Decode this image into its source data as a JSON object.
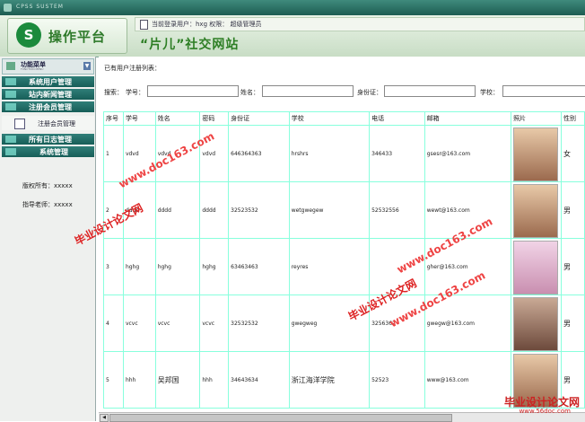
{
  "titlebar": {
    "text": "CPSS SUSTEM"
  },
  "header": {
    "logo_text": "操作平台",
    "user_info": "当前登录用户：hxg  权限：  超级管理员",
    "site_title": "“片儿”社交网站"
  },
  "sidebar": {
    "menu_title": "功能菜单",
    "menu_subtitle": "FUNCTION MENU",
    "items": [
      {
        "label": "系统用户管理"
      },
      {
        "label": "站内新闻管理"
      },
      {
        "label": "注册会员管理"
      }
    ],
    "active_subitem": "注册会员管理",
    "items2": [
      {
        "label": "所有日志管理"
      },
      {
        "label": "系统管理"
      }
    ],
    "copyright": "版权所有：xxxxx",
    "advisor": "指导老师：xxxxx"
  },
  "main": {
    "title": "已有用户注册列表：",
    "search": {
      "label": "搜索：",
      "fields": [
        {
          "label": "学号："
        },
        {
          "label": "姓名："
        },
        {
          "label": "身份证："
        },
        {
          "label": "学校："
        }
      ]
    },
    "columns": [
      "序号",
      "学号",
      "姓名",
      "密码",
      "身份证",
      "学校",
      "电话",
      "邮箱",
      "照片",
      "性别"
    ],
    "rows": [
      {
        "no": "1",
        "sid": "vdvd",
        "name": "vdvd",
        "pwd": "vdvd",
        "idcard": "646364363",
        "school": "hrshrs",
        "phone": "346433",
        "email": "gsesr@163.com",
        "gender": "女"
      },
      {
        "no": "2",
        "sid": "dddd",
        "name": "dddd",
        "pwd": "dddd",
        "idcard": "32523532",
        "school": "wetgwegew",
        "phone": "52532556",
        "email": "wewt@163.com",
        "gender": "男"
      },
      {
        "no": "3",
        "sid": "hghg",
        "name": "hghg",
        "pwd": "hghg",
        "idcard": "63463463",
        "school": "reyres",
        "phone": "",
        "email": "gher@163.com",
        "gender": "男"
      },
      {
        "no": "4",
        "sid": "vcvc",
        "name": "vcvc",
        "pwd": "vcvc",
        "idcard": "32532532",
        "school": "gwegweg",
        "phone": "3256362",
        "email": "gwegw@163.com",
        "gender": "男"
      },
      {
        "no": "5",
        "sid": "hhh",
        "name": "吴邦国",
        "pwd": "hhh",
        "idcard": "34643634",
        "school": "浙江海洋学院",
        "phone": "52523",
        "email": "www@163.com",
        "gender": "男"
      }
    ]
  },
  "watermarks": {
    "cn": "毕业设计论文网",
    "url": "www.doc163.com"
  },
  "bottom_logo": {
    "text": "毕业设计论文网",
    "url": "www.56doc.com"
  }
}
